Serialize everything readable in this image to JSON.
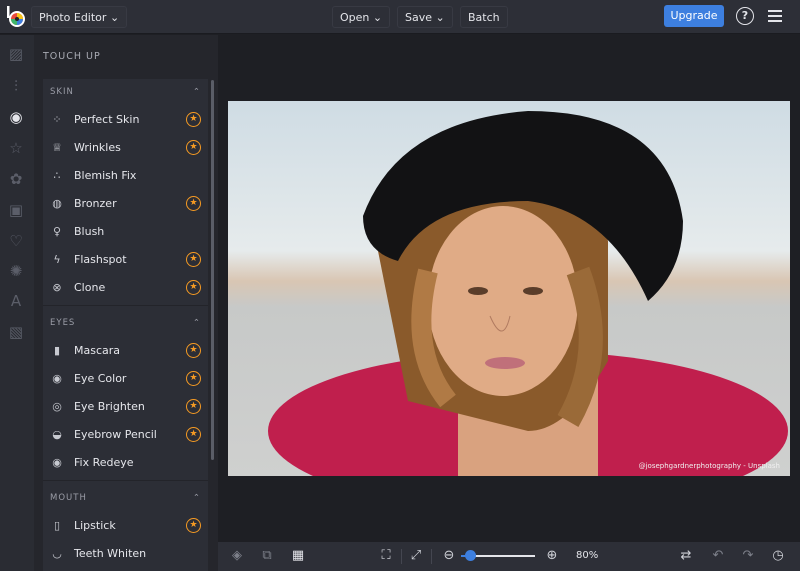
{
  "header": {
    "app_menu": "Photo Editor",
    "open": "Open",
    "save": "Save",
    "batch": "Batch",
    "upgrade": "Upgrade",
    "help": "?"
  },
  "panel": {
    "title": "TOUCH UP",
    "sections": [
      {
        "label": "SKIN",
        "items": [
          {
            "label": "Perfect Skin",
            "icon": "perfect-skin-icon",
            "premium": true
          },
          {
            "label": "Wrinkles",
            "icon": "wrinkles-icon",
            "premium": true
          },
          {
            "label": "Blemish Fix",
            "icon": "blemish-icon",
            "premium": false
          },
          {
            "label": "Bronzer",
            "icon": "bronzer-icon",
            "premium": true
          },
          {
            "label": "Blush",
            "icon": "blush-icon",
            "premium": false
          },
          {
            "label": "Flashspot",
            "icon": "flashspot-icon",
            "premium": true
          },
          {
            "label": "Clone",
            "icon": "clone-icon",
            "premium": true
          }
        ]
      },
      {
        "label": "EYES",
        "items": [
          {
            "label": "Mascara",
            "icon": "mascara-icon",
            "premium": true
          },
          {
            "label": "Eye Color",
            "icon": "eye-icon",
            "premium": true
          },
          {
            "label": "Eye Brighten",
            "icon": "eye-brighten-icon",
            "premium": true
          },
          {
            "label": "Eyebrow Pencil",
            "icon": "eyebrow-icon",
            "premium": true
          },
          {
            "label": "Fix Redeye",
            "icon": "redeye-icon",
            "premium": false
          }
        ]
      },
      {
        "label": "MOUTH",
        "items": [
          {
            "label": "Lipstick",
            "icon": "lipstick-icon",
            "premium": true
          },
          {
            "label": "Teeth Whiten",
            "icon": "teeth-icon",
            "premium": false
          }
        ]
      }
    ]
  },
  "canvas": {
    "credit": "@josephgardnerphotography - Unsplash"
  },
  "bottom": {
    "zoom_label": "80%",
    "zoom_value": 80
  },
  "colors": {
    "accent": "#3d7fdf",
    "premium": "#f59a23"
  }
}
